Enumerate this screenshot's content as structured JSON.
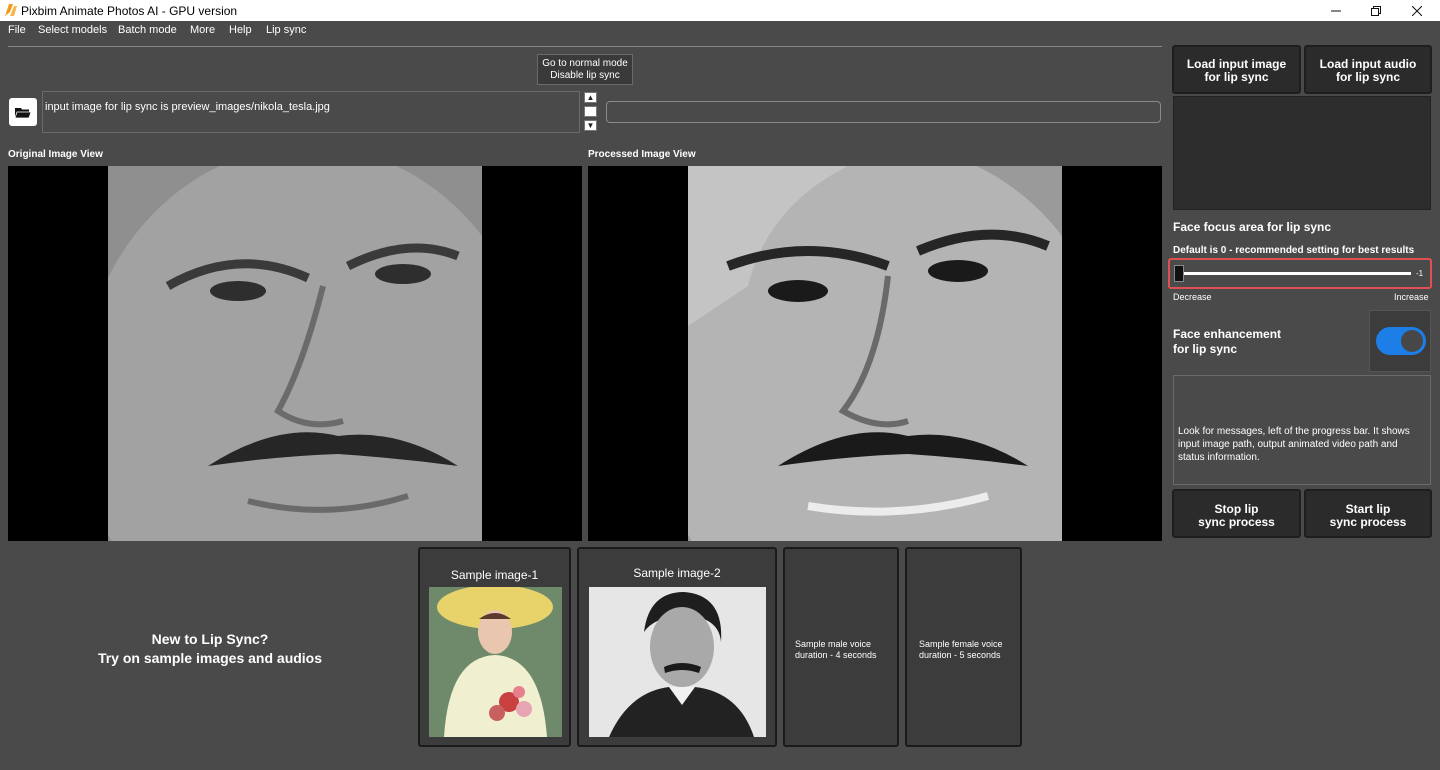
{
  "window": {
    "title": "Pixbim Animate Photos AI - GPU version",
    "minimize": "—",
    "maximize": "❐",
    "close": "✕"
  },
  "menu": [
    "File",
    "Select models",
    "Batch mode",
    "More",
    "Help",
    "Lip sync"
  ],
  "mode_button": {
    "line1": "Go to normal mode",
    "line2": "Disable lip sync"
  },
  "path_text": "input image for lip sync is preview_images/nikola_tesla.jpg",
  "views": {
    "original_label": "Original Image View",
    "processed_label": "Processed Image View"
  },
  "right_panel": {
    "load_image": {
      "line1": "Load input image",
      "line2": "for lip sync"
    },
    "load_audio": {
      "line1": "Load input audio",
      "line2": "for lip sync"
    },
    "face_focus_title": "Face focus area for lip sync",
    "face_focus_sub": "Default is 0 - recommended setting for best results",
    "slider_value": "-1",
    "decrease": "Decrease",
    "increase": "Increase",
    "enh_line1": "Face enhancement",
    "enh_line2": "for lip sync",
    "enhancement_enabled": true,
    "message": "Look for messages, left of the progress bar. It shows input image path, output animated video path and status information.",
    "stop": {
      "line1": "Stop lip",
      "line2": "sync process"
    },
    "start": {
      "line1": "Start lip",
      "line2": "sync process"
    }
  },
  "samples": {
    "intro_line1": "New to Lip Sync?",
    "intro_line2": "Try on sample images and audios",
    "image1": "Sample image-1",
    "image2": "Sample image-2",
    "male_line1": "Sample male voice",
    "male_line2": "duration - 4 seconds",
    "female_line1": "Sample female voice",
    "female_line2": "duration - 5 seconds"
  },
  "colors": {
    "background": "#4a4a4a",
    "toggle_on": "#1e7ee8",
    "highlight": "#e05050"
  }
}
